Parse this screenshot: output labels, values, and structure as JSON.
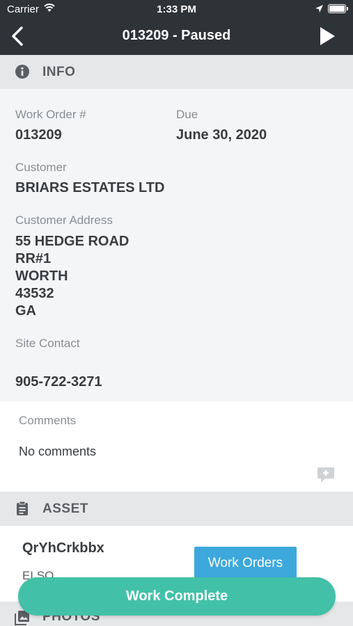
{
  "status_bar": {
    "carrier": "Carrier",
    "time": "1:33 PM"
  },
  "header": {
    "title": "013209 - Paused"
  },
  "info_section": {
    "title": "INFO",
    "work_order_label": "Work Order #",
    "work_order_value": "013209",
    "due_label": "Due",
    "due_value": "June 30, 2020",
    "customer_label": "Customer",
    "customer_value": "BRIARS ESTATES LTD",
    "address_label": "Customer Address",
    "address_lines": [
      "55 HEDGE ROAD",
      "RR#1",
      "WORTH",
      "43532",
      "GA"
    ],
    "site_contact_label": "Site Contact",
    "site_contact_value": "905-722-3271"
  },
  "comments": {
    "label": "Comments",
    "value": "No comments"
  },
  "asset_section": {
    "title": "ASSET",
    "name": "QrYhCrkbbx",
    "subtext": "ELSO",
    "work_orders_label": "Work Orders"
  },
  "photos_section": {
    "title": "PHOTOS"
  },
  "footer": {
    "complete_label": "Work Complete"
  },
  "colors": {
    "header_bg": "#2e3338",
    "accent_blue": "#3da8dc",
    "accent_green": "#42c1a8"
  }
}
